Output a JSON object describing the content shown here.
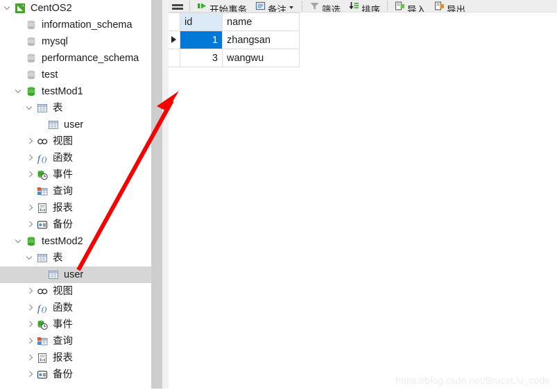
{
  "sidebar": {
    "scrollbar": {
      "name": "vertical-scrollbar"
    },
    "tree": [
      {
        "label": "CentOS2",
        "icon": "connection-icon",
        "indent": 0,
        "chevron": "open",
        "selected": false
      },
      {
        "label": "information_schema",
        "icon": "database-gray-icon",
        "indent": 1,
        "chevron": "none",
        "selected": false
      },
      {
        "label": "mysql",
        "icon": "database-gray-icon",
        "indent": 1,
        "chevron": "none",
        "selected": false
      },
      {
        "label": "performance_schema",
        "icon": "database-gray-icon",
        "indent": 1,
        "chevron": "none",
        "selected": false
      },
      {
        "label": "test",
        "icon": "database-gray-icon",
        "indent": 1,
        "chevron": "none",
        "selected": false
      },
      {
        "label": "testMod1",
        "icon": "database-green-icon",
        "indent": 1,
        "chevron": "open",
        "selected": false
      },
      {
        "label": "表",
        "icon": "table-folder-icon",
        "indent": 2,
        "chevron": "open",
        "selected": false
      },
      {
        "label": "user",
        "icon": "table-icon",
        "indent": 3,
        "chevron": "none",
        "selected": false
      },
      {
        "label": "视图",
        "icon": "view-icon",
        "indent": 2,
        "chevron": "closed",
        "selected": false
      },
      {
        "label": "函数",
        "icon": "function-icon",
        "indent": 2,
        "chevron": "closed",
        "selected": false
      },
      {
        "label": "事件",
        "icon": "event-icon",
        "indent": 2,
        "chevron": "closed",
        "selected": false
      },
      {
        "label": "查询",
        "icon": "query-icon",
        "indent": 2,
        "chevron": "none",
        "selected": false
      },
      {
        "label": "报表",
        "icon": "report-icon",
        "indent": 2,
        "chevron": "closed",
        "selected": false
      },
      {
        "label": "备份",
        "icon": "backup-icon",
        "indent": 2,
        "chevron": "closed",
        "selected": false
      },
      {
        "label": "testMod2",
        "icon": "database-green-icon",
        "indent": 1,
        "chevron": "open",
        "selected": false
      },
      {
        "label": "表",
        "icon": "table-folder-icon",
        "indent": 2,
        "chevron": "open",
        "selected": false
      },
      {
        "label": "user",
        "icon": "table-icon",
        "indent": 3,
        "chevron": "none",
        "selected": true
      },
      {
        "label": "视图",
        "icon": "view-icon",
        "indent": 2,
        "chevron": "closed",
        "selected": false
      },
      {
        "label": "函数",
        "icon": "function-icon",
        "indent": 2,
        "chevron": "closed",
        "selected": false
      },
      {
        "label": "事件",
        "icon": "event-icon",
        "indent": 2,
        "chevron": "closed",
        "selected": false
      },
      {
        "label": "查询",
        "icon": "query-icon",
        "indent": 2,
        "chevron": "closed",
        "selected": false
      },
      {
        "label": "报表",
        "icon": "report-icon",
        "indent": 2,
        "chevron": "closed",
        "selected": false
      },
      {
        "label": "备份",
        "icon": "backup-icon",
        "indent": 2,
        "chevron": "closed",
        "selected": false
      }
    ]
  },
  "toolbar": {
    "menu_label": "",
    "items": [
      {
        "label": "开始事务",
        "icon": "begin-transaction-icon",
        "caret": false
      },
      {
        "label": "备注",
        "icon": "note-icon",
        "caret": true
      },
      {
        "label": "筛选",
        "icon": "filter-icon",
        "caret": false
      },
      {
        "label": "排序",
        "icon": "sort-icon",
        "caret": false
      },
      {
        "label": "导入",
        "icon": "import-icon",
        "caret": false
      },
      {
        "label": "导出",
        "icon": "export-icon",
        "caret": false
      }
    ]
  },
  "grid": {
    "columns": [
      "id",
      "name"
    ],
    "rows": [
      {
        "id": "1",
        "name": "zhangsan",
        "current": true
      },
      {
        "id": "3",
        "name": "wangwu",
        "current": false
      }
    ],
    "selected_cell": {
      "row": 0,
      "column": "id"
    },
    "selection_color": "#0078d7"
  },
  "annotation": {
    "arrow_color": "#f80000",
    "arrow_name": "red-pointer-arrow"
  },
  "watermark": {
    "text": "https://blog.csdn.net/BruceLiu_code"
  }
}
